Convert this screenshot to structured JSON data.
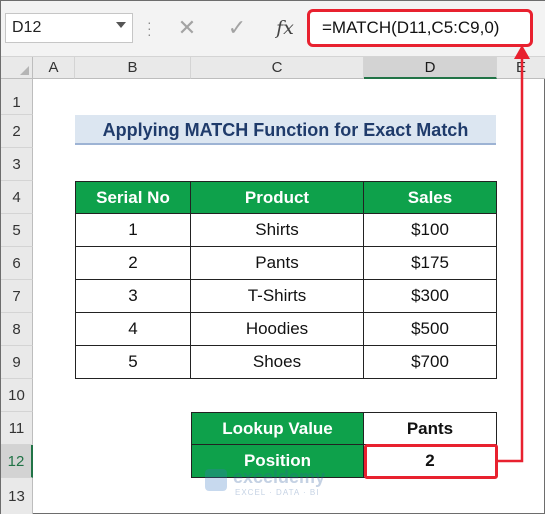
{
  "name_box": {
    "value": "D12"
  },
  "formula_bar": {
    "cancel_icon": "close-icon",
    "enter_icon": "check-icon",
    "fx_label": "fx",
    "formula": "=MATCH(D11,C5:C9,0)"
  },
  "columns": [
    "A",
    "B",
    "C",
    "D",
    "E"
  ],
  "rows": [
    "1",
    "2",
    "3",
    "4",
    "5",
    "6",
    "7",
    "8",
    "9",
    "10",
    "11",
    "12",
    "13"
  ],
  "sheet": {
    "title": "Applying MATCH Function for Exact Match",
    "table_headers": [
      "Serial No",
      "Product",
      "Sales"
    ],
    "table_rows": [
      [
        "1",
        "Shirts",
        "$100"
      ],
      [
        "2",
        "Pants",
        "$175"
      ],
      [
        "3",
        "T-Shirts",
        "$300"
      ],
      [
        "4",
        "Hoodies",
        "$500"
      ],
      [
        "5",
        "Shoes",
        "$700"
      ]
    ],
    "lookup_label": "Lookup Value",
    "lookup_value": "Pants",
    "position_label": "Position",
    "position_value": "2"
  },
  "watermark": {
    "name": "exceldemy",
    "tagline": "EXCEL · DATA · BI"
  },
  "colors": {
    "header_green": "#0ea14b",
    "title_fill": "#dce6f1",
    "highlight_red": "#e8212f",
    "excel_green": "#217346"
  }
}
